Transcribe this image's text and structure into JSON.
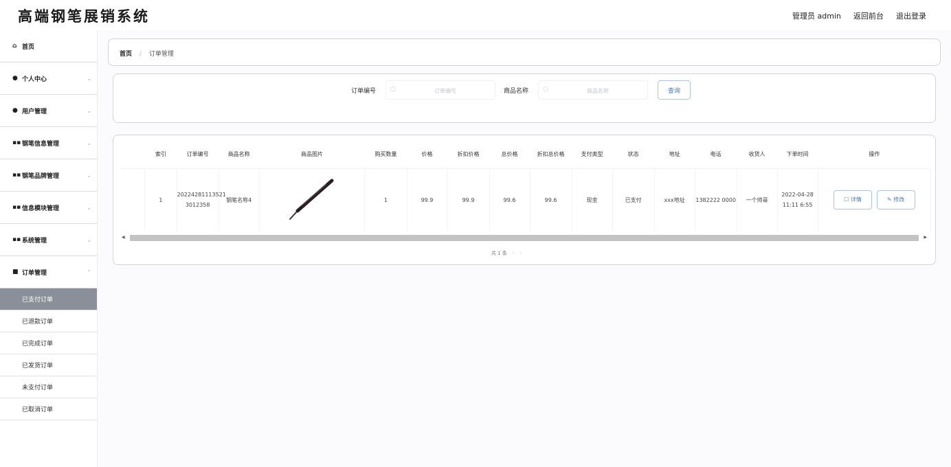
{
  "app": {
    "title": "高端钢笔展销系统"
  },
  "header": {
    "user_label": "管理员 admin",
    "home_link": "返回前台",
    "logout_link": "退出登录"
  },
  "sidebar": {
    "items": [
      {
        "label": "首页",
        "icon": "home-icon"
      },
      {
        "label": "个人中心",
        "icon": "user-icon"
      },
      {
        "label": "用户管理",
        "icon": "users-icon"
      },
      {
        "label": "钢笔信息管理",
        "icon": "grid-icon"
      },
      {
        "label": "钢笔品牌管理",
        "icon": "grid-icon"
      },
      {
        "label": "信息模块管理",
        "icon": "grid-icon"
      },
      {
        "label": "系统管理",
        "icon": "grid-icon"
      },
      {
        "label": "订单管理",
        "icon": "order-icon"
      }
    ],
    "sub_items": [
      {
        "label": "已支付订单",
        "active": true
      },
      {
        "label": "已退款订单",
        "active": false
      },
      {
        "label": "已完成订单",
        "active": false
      },
      {
        "label": "已发货订单",
        "active": false
      },
      {
        "label": "未支付订单",
        "active": false
      },
      {
        "label": "已取消订单",
        "active": false
      }
    ]
  },
  "breadcrumb": {
    "home": "首页",
    "current": "订单管理"
  },
  "search": {
    "order_label": "订单编号",
    "order_placeholder": "订单编号",
    "product_label": "商品名称",
    "product_placeholder": "商品名称",
    "query_button": "查询"
  },
  "table": {
    "headers": [
      "索引",
      "订单编号",
      "商品名称",
      "商品图片",
      "购买数量",
      "价格",
      "折扣价格",
      "总价格",
      "折扣总价格",
      "支付类型",
      "状态",
      "地址",
      "电话",
      "收货人",
      "下单时间",
      "操作"
    ],
    "rows": [
      {
        "index": "1",
        "order_no": "20224281113521 3012358",
        "product_name": "钢笔名称4",
        "qty": "1",
        "price": "99.9",
        "discount_price": "99.9",
        "total": "99.6",
        "discount_total": "99.6",
        "pay_type": "现金",
        "status": "已支付",
        "address": "xxx地址",
        "phone": "1382222 0000",
        "receiver": "一个帅哥",
        "order_time": "2022-04-28 11:11 6:55",
        "detail_btn": "详情",
        "edit_btn": "修改"
      }
    ]
  },
  "pagination": {
    "total_text": "共 1 条"
  },
  "colors": {
    "sidebar_active": "#8a8f99",
    "button_border": "#a8c4e8",
    "button_text": "#4a7ab8"
  }
}
